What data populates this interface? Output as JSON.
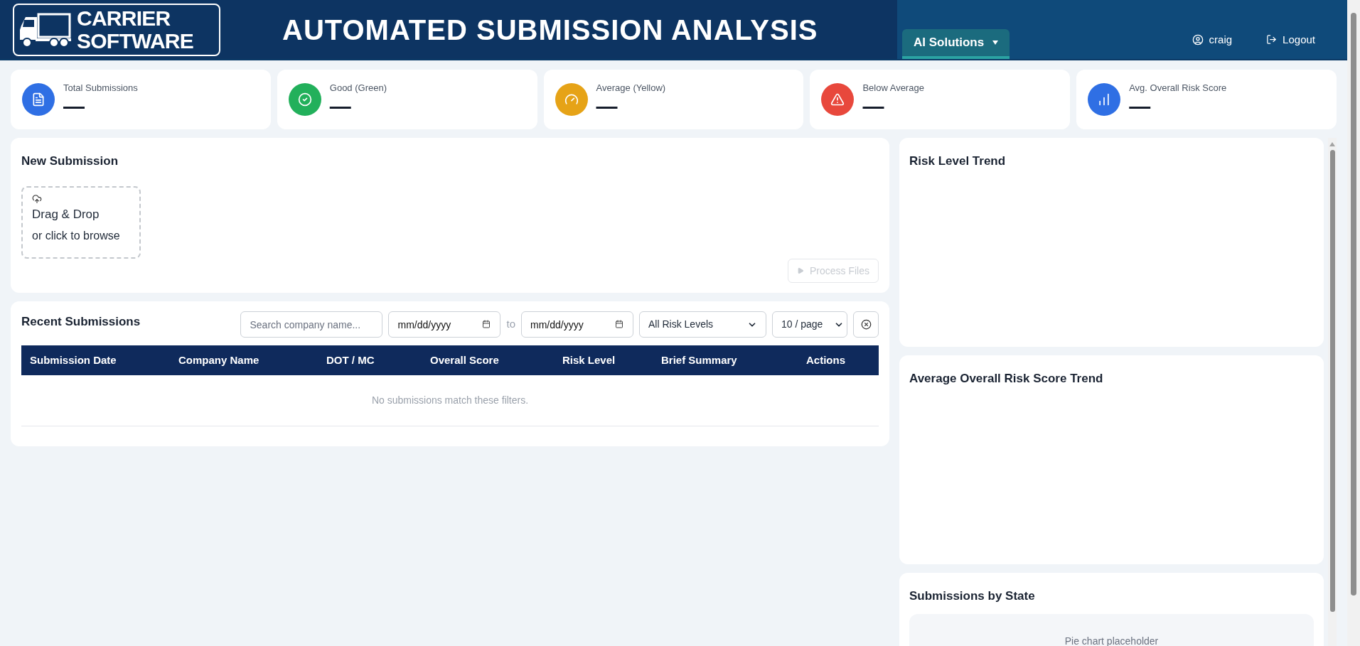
{
  "header": {
    "logo": [
      "CARRIER",
      "SOFTWARE"
    ],
    "title": "AUTOMATED SUBMISSION ANALYSIS",
    "menu": {
      "label": "AI Solutions",
      "selected": true
    },
    "user": "craig",
    "logout": "Logout"
  },
  "stats": [
    {
      "kind": "document",
      "label": "Total Submissions",
      "value": "—",
      "color": "#2f6fe4"
    },
    {
      "kind": "check",
      "label": "Good (Green)",
      "value": "—",
      "color": "#22b05b"
    },
    {
      "kind": "gauge",
      "label": "Average (Yellow)",
      "value": "—",
      "color": "#e6a317"
    },
    {
      "kind": "warning",
      "label": "Below Average",
      "value": "—",
      "color": "#e8483c"
    },
    {
      "kind": "bars",
      "label": "Avg. Overall Risk Score",
      "value": "—",
      "color": "#2f6fe4"
    }
  ],
  "new_submission": {
    "title": "New Submission",
    "dropzone": {
      "title": "Drag & Drop",
      "hint": "or click to browse"
    },
    "button": {
      "label": "Process Files",
      "disabled": true
    }
  },
  "recent": {
    "title": "Recent Submissions",
    "search": {
      "placeholder": "Search company name..."
    },
    "date_from": {
      "placeholder": "mm/dd/yyyy"
    },
    "separator": "to",
    "date_to": {
      "placeholder": "mm/dd/yyyy"
    },
    "risk_filter": {
      "value": "All Risk Levels"
    },
    "page_size": {
      "value": "10 / page"
    },
    "table": {
      "columns": [
        "Submission Date",
        "Company Name",
        "DOT / MC",
        "Overall Score",
        "Risk Level",
        "Brief Summary",
        "Actions"
      ],
      "empty_message": "No submissions match these filters."
    }
  },
  "charts": [
    {
      "title": "Risk Level Trend"
    },
    {
      "title": "Average Overall Risk Score Trend"
    },
    {
      "title": "Submissions by State",
      "placeholder": "Pie chart placeholder"
    }
  ]
}
